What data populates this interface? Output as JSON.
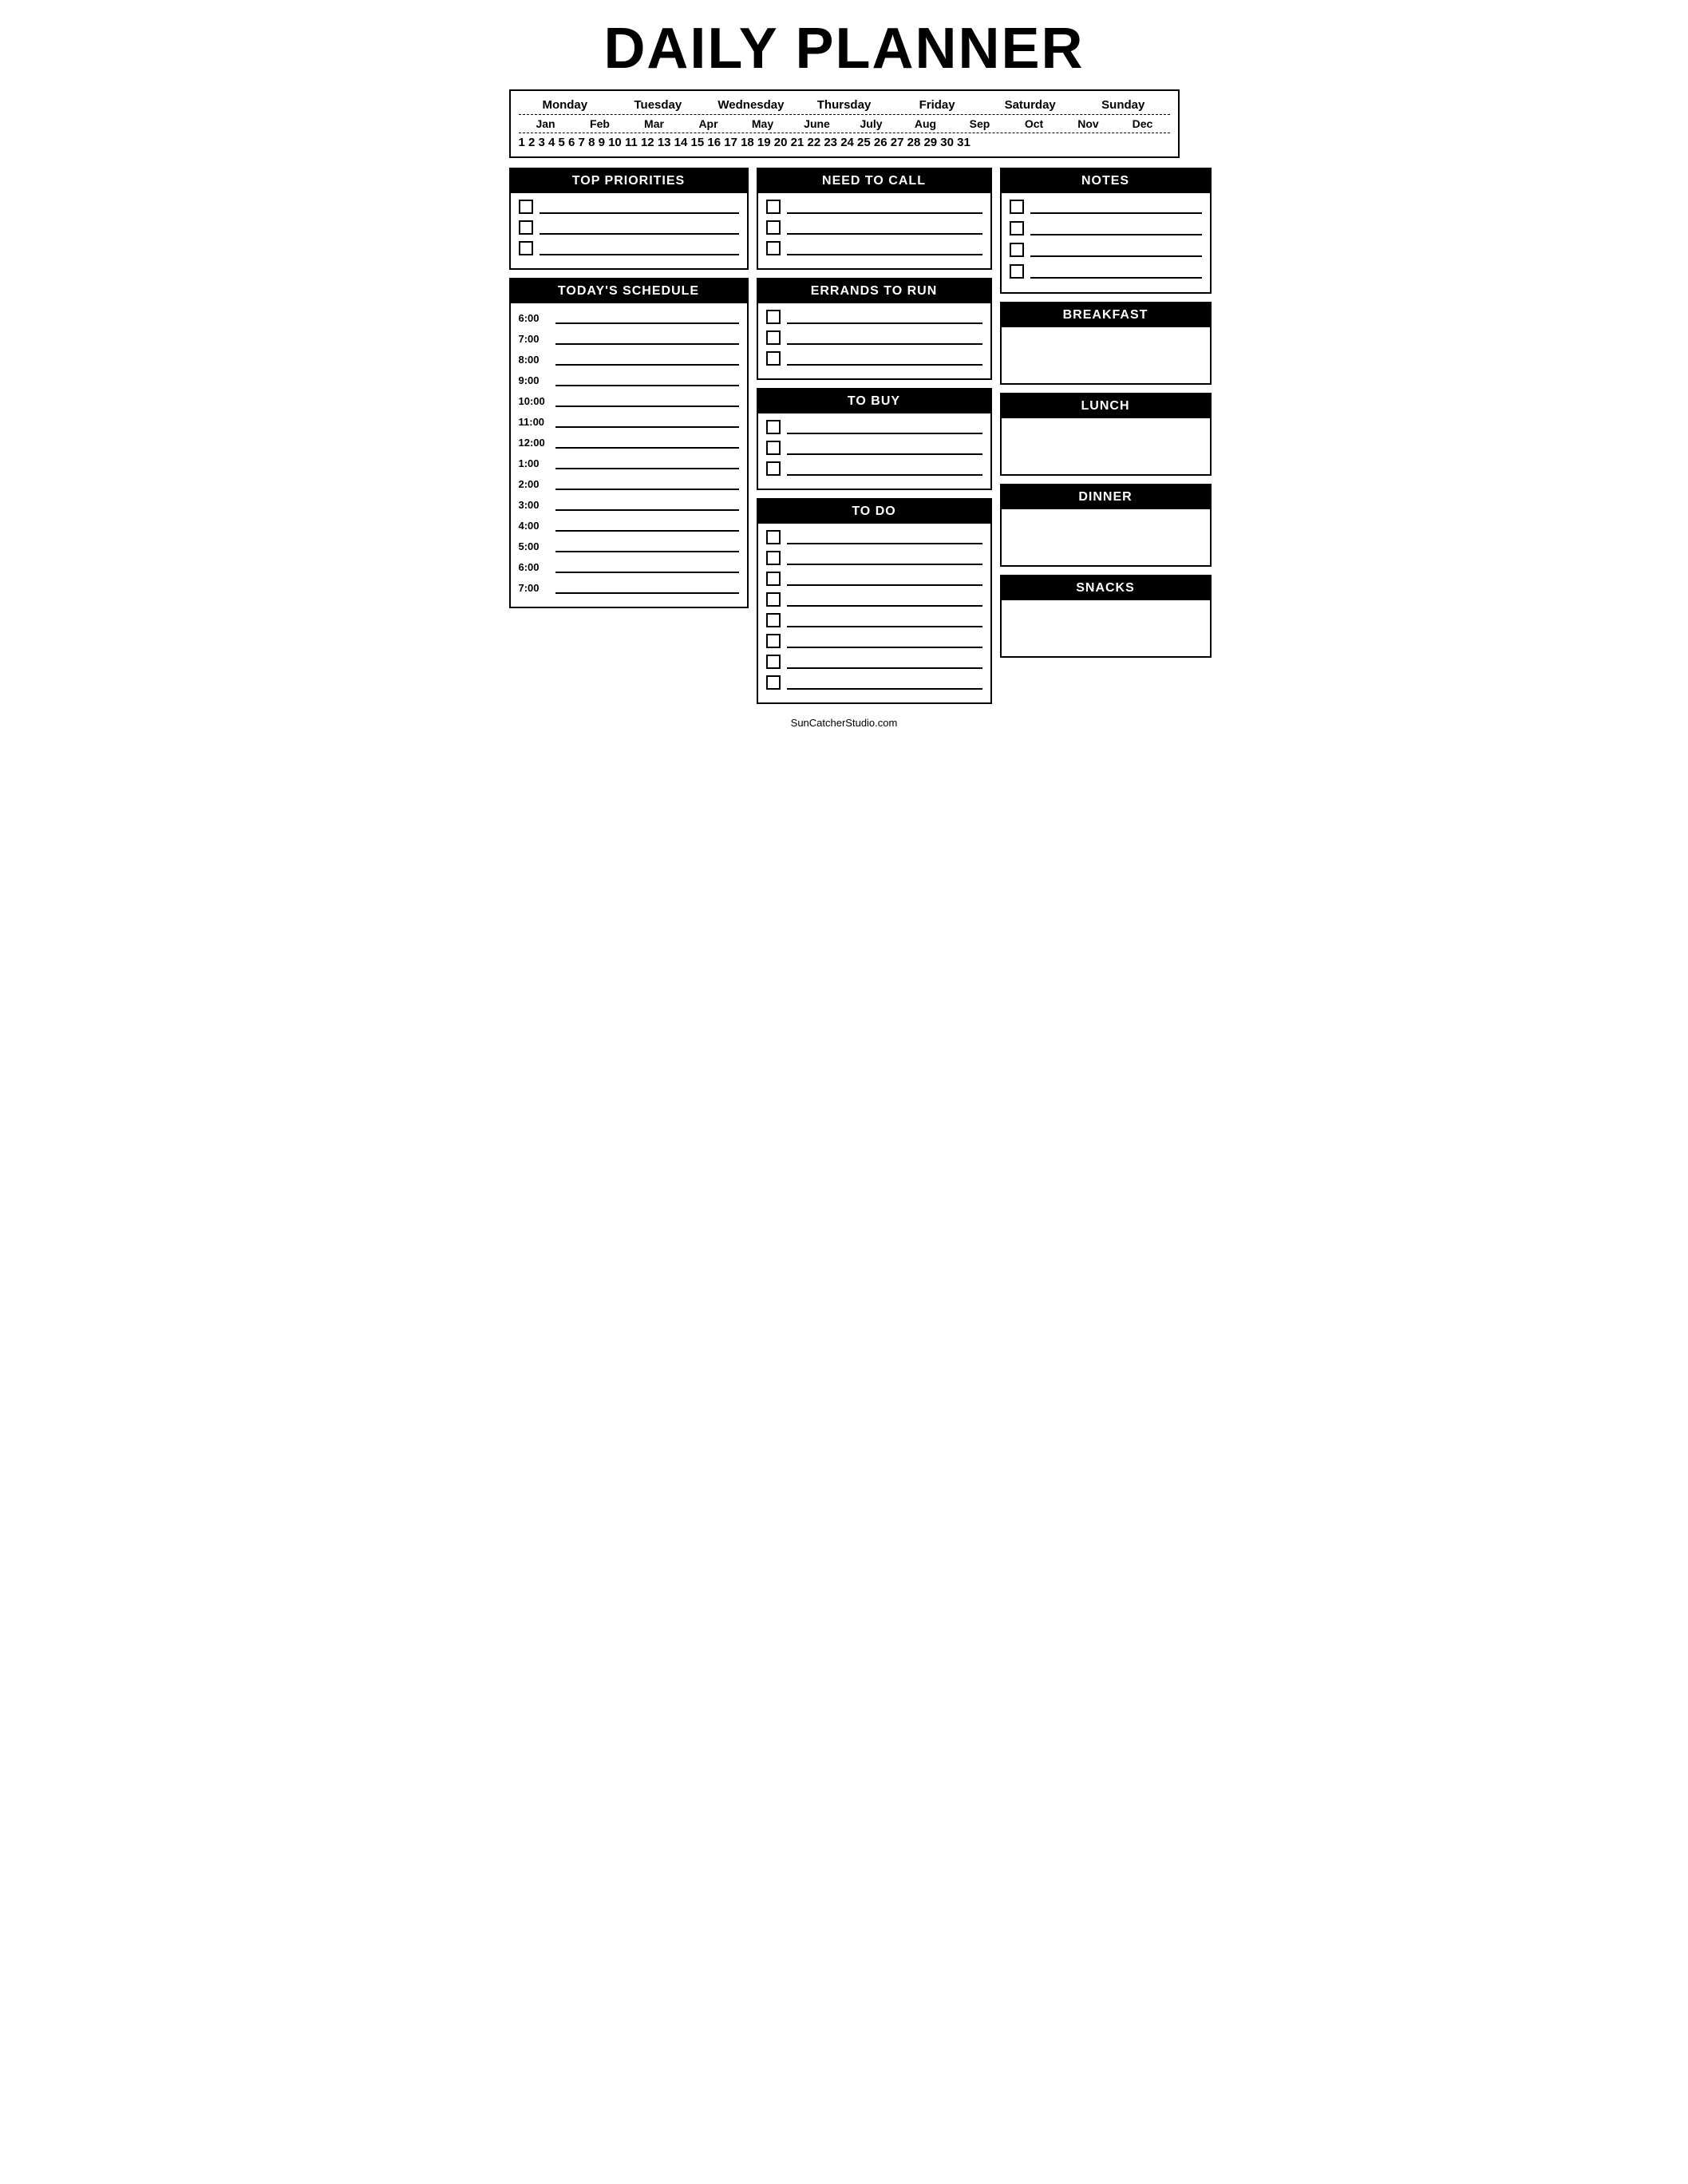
{
  "title": "DAILY PLANNER",
  "days": [
    "Monday",
    "Tuesday",
    "Wednesday",
    "Thursday",
    "Friday",
    "Saturday",
    "Sunday"
  ],
  "months": [
    "Jan",
    "Feb",
    "Mar",
    "Apr",
    "May",
    "June",
    "July",
    "Aug",
    "Sep",
    "Oct",
    "Nov",
    "Dec"
  ],
  "dates": [
    "1",
    "2",
    "3",
    "4",
    "5",
    "6",
    "7",
    "8",
    "9",
    "10",
    "11",
    "12",
    "13",
    "14",
    "15",
    "16",
    "17",
    "18",
    "19",
    "20",
    "21",
    "22",
    "23",
    "24",
    "25",
    "26",
    "27",
    "28",
    "29",
    "30",
    "31"
  ],
  "top_priorities": {
    "header": "TOP PRIORITIES",
    "items": 3
  },
  "need_to_call": {
    "header": "NEED TO CALL",
    "items": 3
  },
  "notes": {
    "header": "NOTES",
    "items": 4
  },
  "todays_schedule": {
    "header": "TODAY'S SCHEDULE",
    "times": [
      "6:00",
      "7:00",
      "8:00",
      "9:00",
      "10:00",
      "11:00",
      "12:00",
      "1:00",
      "2:00",
      "3:00",
      "4:00",
      "5:00",
      "6:00",
      "7:00"
    ]
  },
  "errands_to_run": {
    "header": "ERRANDS TO RUN",
    "items": 3
  },
  "to_buy": {
    "header": "TO BUY",
    "items": 3
  },
  "to_do": {
    "header": "TO DO",
    "items": 8
  },
  "breakfast": {
    "header": "BREAKFAST"
  },
  "lunch": {
    "header": "LUNCH"
  },
  "dinner": {
    "header": "DINNER"
  },
  "snacks": {
    "header": "SNACKS"
  },
  "footer": "SunCatcherStudio.com"
}
